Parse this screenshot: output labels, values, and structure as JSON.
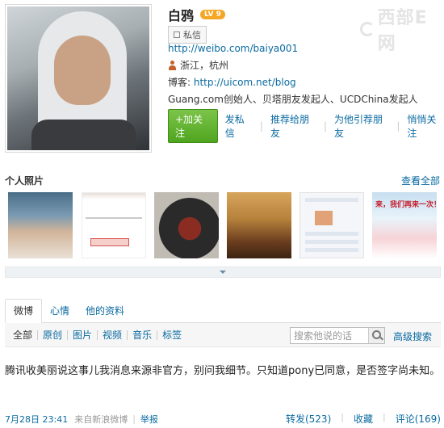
{
  "profile": {
    "name": "白鸦",
    "level": "LV 9",
    "message_badge": "私信",
    "weibo_url": "http://weibo.com/baiya001",
    "location": "浙江，杭州",
    "blog_label": "博客:",
    "blog_url": "http://uicom.net/blog",
    "intro": "Guang.com创始人、贝塔朋友发起人、UCDChina发起人"
  },
  "watermark": "西部E网",
  "actions": {
    "follow": "+加关注",
    "send_message": "发私信",
    "recommend": "推荐给朋友",
    "recommend_to_him": "为他引荐朋友",
    "unfollow_quietly": "悄悄关注"
  },
  "photos": {
    "title": "个人照片",
    "see_all": "查看全部",
    "p6_text": "来，我们再来一次！"
  },
  "tabs": [
    {
      "label": "微博"
    },
    {
      "label": "心情"
    },
    {
      "label": "他的资料"
    }
  ],
  "filters": {
    "items": [
      "全部",
      "原创",
      "图片",
      "视频",
      "音乐",
      "标签"
    ],
    "search_placeholder": "搜索他说的话",
    "advanced_search": "高级搜索"
  },
  "post": {
    "text": "腾讯收美丽说这事儿我消息来源非官方，别问我细节。只知道pony已同意，是否签字尚未知。",
    "time": "7月28日 23:41",
    "source": "来自新浪微博",
    "report": "举报",
    "repost": "转发(523)",
    "favorite": "收藏",
    "comment": "评论(169)"
  },
  "colors": {
    "link": "#0a6aa1",
    "follow_button": "#4fa51f",
    "level_badge": "#f5a623"
  }
}
